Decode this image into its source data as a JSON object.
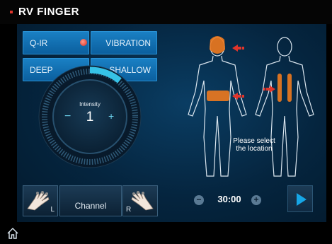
{
  "app": {
    "title": "RV FINGER"
  },
  "mode_buttons": {
    "qir": "Q-IR",
    "vibration": "VIBRATION",
    "deep": "DEEP",
    "shallow": "SHALLOW"
  },
  "intensity": {
    "label": "Intensity",
    "value": "1",
    "minus": "−",
    "plus": "+",
    "level_fraction": 0.1
  },
  "channel": {
    "label": "Channel",
    "left": "L",
    "right": "R"
  },
  "timer": {
    "value": "30:00",
    "minus": "−",
    "plus": "+"
  },
  "location": {
    "prompt_line1": "Please select",
    "prompt_line2": "the location"
  },
  "colors": {
    "accent": "#1a80c4",
    "indicator": "#e0352b",
    "highlight": "#f07a1e",
    "arc": "#36c2e6"
  },
  "icons": [
    "home-icon",
    "play-icon",
    "hand-left-icon",
    "hand-right-icon",
    "arrow-left-icon",
    "arrow-right-icon"
  ]
}
